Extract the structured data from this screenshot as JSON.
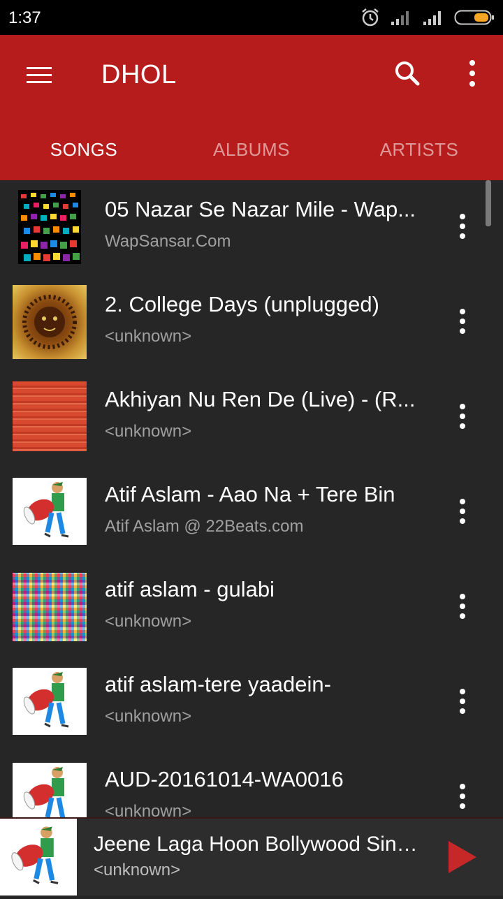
{
  "status": {
    "time": "1:37"
  },
  "app_bar": {
    "title": "DHOL"
  },
  "tabs": [
    {
      "label": "SONGS",
      "active": true
    },
    {
      "label": "ALBUMS",
      "active": false
    },
    {
      "label": "ARTISTS",
      "active": false
    }
  ],
  "songs": [
    {
      "title": "05 Nazar Se Nazar Mile  - Wap...",
      "artist": "WapSansar.Com",
      "art": "colorful-dots"
    },
    {
      "title": "2. College Days (unplugged)",
      "artist": "<unknown>",
      "art": "lion-mosaic"
    },
    {
      "title": "Akhiyan Nu Ren De (Live) - (R...",
      "artist": "<unknown>",
      "art": "red-stripes"
    },
    {
      "title": "Atif Aslam - Aao Na + Tere Bin",
      "artist": "Atif Aslam @ 22Beats.com",
      "art": "dhol-player"
    },
    {
      "title": "atif aslam - gulabi",
      "artist": "<unknown>",
      "art": "pixel-noise"
    },
    {
      "title": "atif aslam-tere yaadein-",
      "artist": "<unknown>",
      "art": "dhol-player"
    },
    {
      "title": "AUD-20161014-WA0016",
      "artist": "<unknown>",
      "art": "dhol-player"
    }
  ],
  "now_playing": {
    "title": "Jeene Laga Hoon Bollywood Sing...",
    "artist": "<unknown>",
    "art": "dhol-player"
  },
  "icons": {
    "menu": "menu-icon",
    "search": "search-icon",
    "more": "more-vert-icon",
    "play": "play-icon",
    "alarm": "alarm-icon",
    "signal": "signal-icon",
    "battery": "battery-icon"
  },
  "colors": {
    "primary": "#b71c1c",
    "background": "#262626",
    "accent": "#c62828"
  }
}
